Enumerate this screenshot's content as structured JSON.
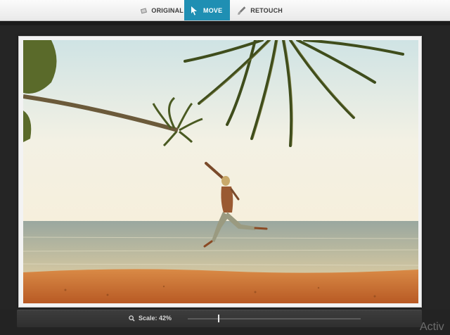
{
  "toolbar": {
    "tabs": [
      {
        "label": "ORIGINAL",
        "icon": "photo-icon",
        "active": false
      },
      {
        "label": "MOVE",
        "icon": "cursor-icon",
        "active": true
      },
      {
        "label": "RETOUCH",
        "icon": "brush-icon",
        "active": false
      }
    ],
    "active_color": "#1f8fb3"
  },
  "canvas": {
    "image_description_icon": "beach-photo"
  },
  "scale": {
    "label": "Scale: 42%",
    "value_percent": 42,
    "icon": "magnifier-icon"
  },
  "watermark": {
    "text": "Activ"
  }
}
